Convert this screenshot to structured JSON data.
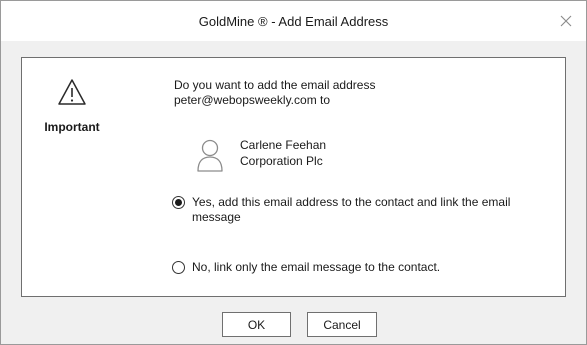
{
  "window": {
    "title": "GoldMine ® - Add Email Address"
  },
  "dialog": {
    "icon": "warning-icon",
    "important_label": "Important",
    "question_line1": "Do you want to add the email address",
    "question_line2": "peter@webopsweekly.com to",
    "contact": {
      "icon": "person-icon",
      "name": "Carlene Feehan",
      "company": "Corporation Plc"
    },
    "options": [
      {
        "label": "Yes, add this email address to the contact and link the email message",
        "selected": true
      },
      {
        "label": "No, link only the email message to the contact.",
        "selected": false
      }
    ]
  },
  "buttons": {
    "ok_label": "OK",
    "cancel_label": "Cancel"
  },
  "colors": {
    "titlebar": "#ffffff",
    "window_bg": "#f0f0f0",
    "panel_bg": "#ffffff",
    "border": "#6f6f6f"
  }
}
